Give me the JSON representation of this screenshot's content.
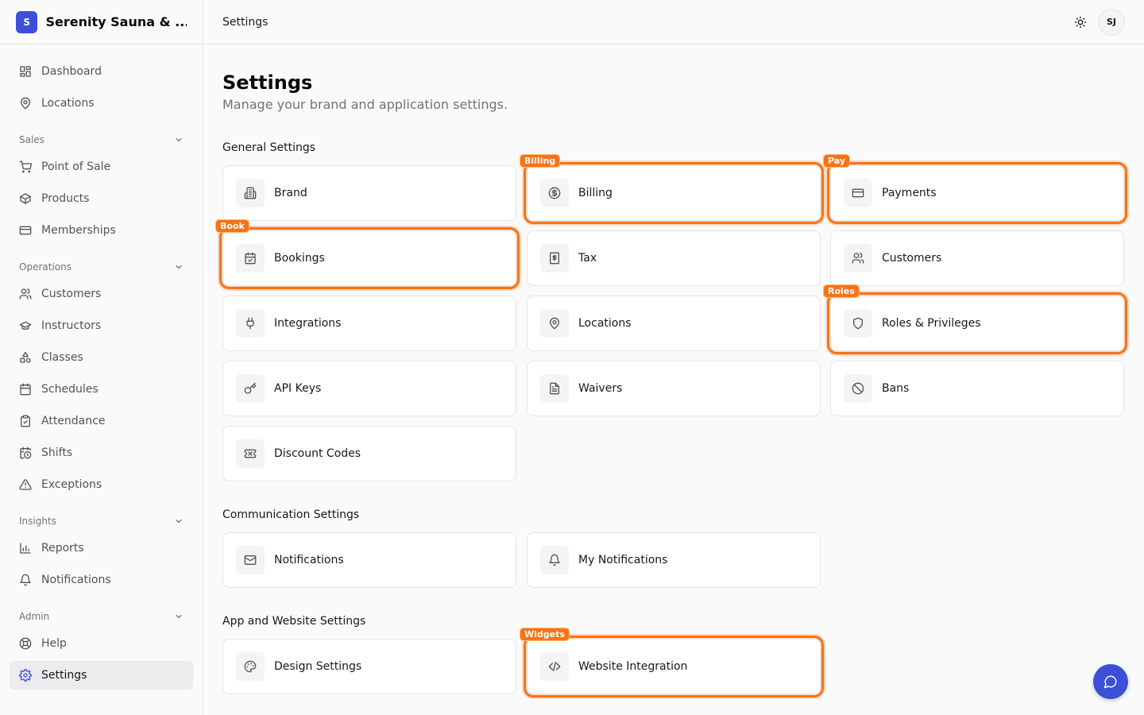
{
  "brand": {
    "logo_letter": "S",
    "name": "Serenity Sauna & ..."
  },
  "sidebar": {
    "top_items": [
      {
        "label": "Dashboard",
        "icon": "dashboard-icon"
      },
      {
        "label": "Locations",
        "icon": "map-pin-icon"
      }
    ],
    "groups": [
      {
        "label": "Sales",
        "items": [
          {
            "label": "Point of Sale",
            "icon": "cart-icon"
          },
          {
            "label": "Products",
            "icon": "box-icon"
          },
          {
            "label": "Memberships",
            "icon": "card-icon"
          }
        ]
      },
      {
        "label": "Operations",
        "items": [
          {
            "label": "Customers",
            "icon": "users-icon"
          },
          {
            "label": "Instructors",
            "icon": "graduation-cap-icon"
          },
          {
            "label": "Classes",
            "icon": "shapes-icon"
          },
          {
            "label": "Schedules",
            "icon": "calendar-icon"
          },
          {
            "label": "Attendance",
            "icon": "clipboard-check-icon"
          },
          {
            "label": "Shifts",
            "icon": "calendar-clock-icon"
          },
          {
            "label": "Exceptions",
            "icon": "warning-icon"
          }
        ]
      },
      {
        "label": "Insights",
        "items": [
          {
            "label": "Reports",
            "icon": "bar-chart-icon"
          },
          {
            "label": "Notifications",
            "icon": "bell-icon"
          }
        ]
      },
      {
        "label": "Admin",
        "items": [
          {
            "label": "Help",
            "icon": "life-buoy-icon"
          },
          {
            "label": "Settings",
            "icon": "gear-icon",
            "active": true
          }
        ]
      }
    ]
  },
  "topbar": {
    "title": "Settings",
    "avatar_initials": "SJ"
  },
  "page": {
    "title": "Settings",
    "subtitle": "Manage your brand and application settings."
  },
  "sections": {
    "general": {
      "title": "General Settings",
      "cards": [
        {
          "label": "Brand",
          "icon": "building-icon"
        },
        {
          "label": "Billing",
          "icon": "dollar-circle-icon",
          "tag": "Billing"
        },
        {
          "label": "Payments",
          "icon": "credit-card-icon",
          "tag": "Pay"
        },
        {
          "label": "Bookings",
          "icon": "calendar-check-icon",
          "tag": "Book"
        },
        {
          "label": "Tax",
          "icon": "receipt-icon"
        },
        {
          "label": "Customers",
          "icon": "users-icon"
        },
        {
          "label": "Integrations",
          "icon": "plug-icon"
        },
        {
          "label": "Locations",
          "icon": "map-pin-icon"
        },
        {
          "label": "Roles & Privileges",
          "icon": "shield-icon",
          "tag": "Roles"
        },
        {
          "label": "API Keys",
          "icon": "key-icon"
        },
        {
          "label": "Waivers",
          "icon": "file-text-icon"
        },
        {
          "label": "Bans",
          "icon": "ban-icon"
        },
        {
          "label": "Discount Codes",
          "icon": "ticket-icon"
        }
      ]
    },
    "communication": {
      "title": "Communication Settings",
      "cards": [
        {
          "label": "Notifications",
          "icon": "mail-icon"
        },
        {
          "label": "My Notifications",
          "icon": "bell-icon"
        }
      ]
    },
    "app": {
      "title": "App and Website Settings",
      "cards": [
        {
          "label": "Design Settings",
          "icon": "palette-icon"
        },
        {
          "label": "Website Integration",
          "icon": "code-icon",
          "tag": "Widgets"
        }
      ]
    }
  },
  "colors": {
    "accent": "#3b4fd8",
    "highlight": "#f97316"
  }
}
